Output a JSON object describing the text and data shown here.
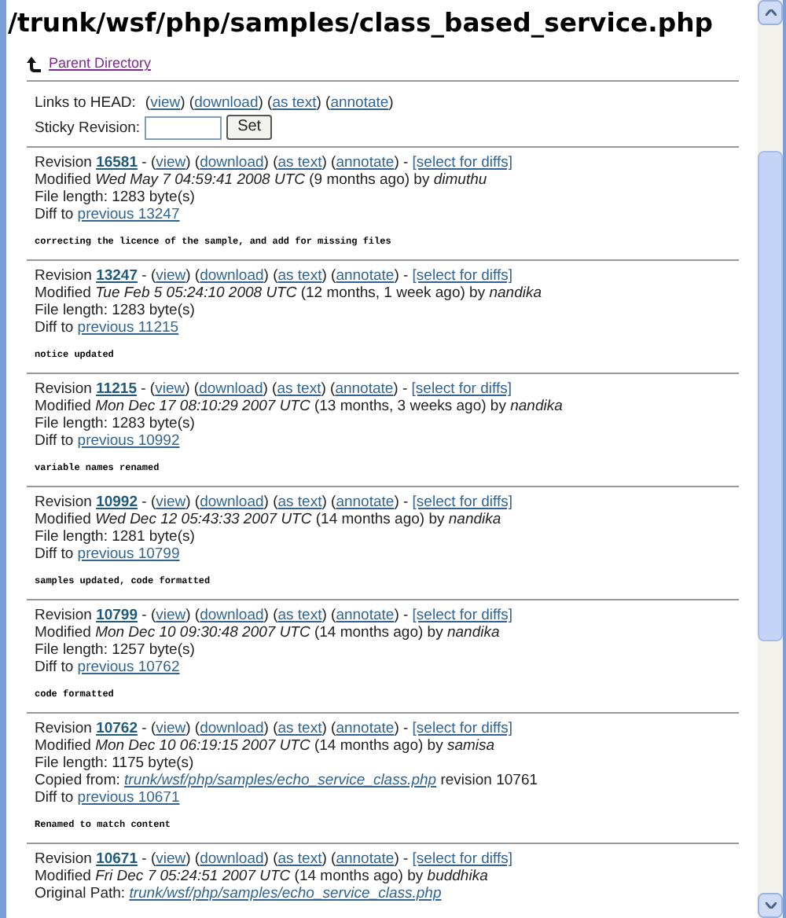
{
  "title": "/trunk/wsf/php/samples/class_based_service.php",
  "parent_link": "Parent Directory",
  "head_links": [
    {
      "text": "Links to HEAD:",
      "kind": "label"
    },
    {
      "text": "(",
      "kind": "plain"
    },
    {
      "text": "view",
      "kind": "link"
    },
    {
      "text": ") (",
      "kind": "plain"
    },
    {
      "text": "download",
      "kind": "link"
    },
    {
      "text": ") (",
      "kind": "plain"
    },
    {
      "text": "as text",
      "kind": "link"
    },
    {
      "text": ") (",
      "kind": "plain"
    },
    {
      "text": "annotate",
      "kind": "link"
    },
    {
      "text": ")",
      "kind": "plain"
    }
  ],
  "sticky": {
    "label": "Sticky Revision:",
    "button": "Set"
  },
  "revisions": [
    {
      "lines": [
        [
          {
            "text": "Revision ",
            "kind": "plain"
          },
          {
            "text": "16581",
            "kind": "bold-link"
          },
          {
            "text": " - (",
            "kind": "plain"
          },
          {
            "text": "view",
            "kind": "link"
          },
          {
            "text": ") (",
            "kind": "plain"
          },
          {
            "text": "download",
            "kind": "link"
          },
          {
            "text": ") (",
            "kind": "plain"
          },
          {
            "text": "as text",
            "kind": "link"
          },
          {
            "text": ") (",
            "kind": "plain"
          },
          {
            "text": "annotate",
            "kind": "link"
          },
          {
            "text": ") - ",
            "kind": "plain"
          },
          {
            "text": "[select for diffs]",
            "kind": "link"
          }
        ],
        [
          {
            "text": "Modified ",
            "kind": "plain"
          },
          {
            "text": "Wed May 7 04:59:41 2008 UTC",
            "kind": "italic"
          },
          {
            "text": " (9 months ago) by ",
            "kind": "plain"
          },
          {
            "text": "dimuthu",
            "kind": "italic"
          }
        ],
        [
          {
            "text": "File length: 1283 byte(s)",
            "kind": "plain"
          }
        ],
        [
          {
            "text": "Diff to ",
            "kind": "plain"
          },
          {
            "text": "previous 13247",
            "kind": "link"
          }
        ]
      ],
      "log": "correcting the licence of the sample, and add for missing files"
    },
    {
      "lines": [
        [
          {
            "text": "Revision ",
            "kind": "plain"
          },
          {
            "text": "13247",
            "kind": "bold-link"
          },
          {
            "text": " - (",
            "kind": "plain"
          },
          {
            "text": "view",
            "kind": "link"
          },
          {
            "text": ") (",
            "kind": "plain"
          },
          {
            "text": "download",
            "kind": "link"
          },
          {
            "text": ") (",
            "kind": "plain"
          },
          {
            "text": "as text",
            "kind": "link"
          },
          {
            "text": ") (",
            "kind": "plain"
          },
          {
            "text": "annotate",
            "kind": "link"
          },
          {
            "text": ") - ",
            "kind": "plain"
          },
          {
            "text": "[select for diffs]",
            "kind": "link"
          }
        ],
        [
          {
            "text": "Modified ",
            "kind": "plain"
          },
          {
            "text": "Tue Feb 5 05:24:10 2008 UTC",
            "kind": "italic"
          },
          {
            "text": " (12 months, 1 week ago) by ",
            "kind": "plain"
          },
          {
            "text": "nandika",
            "kind": "italic"
          }
        ],
        [
          {
            "text": "File length: 1283 byte(s)",
            "kind": "plain"
          }
        ],
        [
          {
            "text": "Diff to ",
            "kind": "plain"
          },
          {
            "text": "previous 11215",
            "kind": "link"
          }
        ]
      ],
      "log": "notice updated"
    },
    {
      "lines": [
        [
          {
            "text": "Revision ",
            "kind": "plain"
          },
          {
            "text": "11215",
            "kind": "bold-link"
          },
          {
            "text": " - (",
            "kind": "plain"
          },
          {
            "text": "view",
            "kind": "link"
          },
          {
            "text": ") (",
            "kind": "plain"
          },
          {
            "text": "download",
            "kind": "link"
          },
          {
            "text": ") (",
            "kind": "plain"
          },
          {
            "text": "as text",
            "kind": "link"
          },
          {
            "text": ") (",
            "kind": "plain"
          },
          {
            "text": "annotate",
            "kind": "link"
          },
          {
            "text": ") - ",
            "kind": "plain"
          },
          {
            "text": "[select for diffs]",
            "kind": "link"
          }
        ],
        [
          {
            "text": "Modified ",
            "kind": "plain"
          },
          {
            "text": "Mon Dec 17 08:10:29 2007 UTC",
            "kind": "italic"
          },
          {
            "text": " (13 months, 3 weeks ago) by ",
            "kind": "plain"
          },
          {
            "text": "nandika",
            "kind": "italic"
          }
        ],
        [
          {
            "text": "File length: 1283 byte(s)",
            "kind": "plain"
          }
        ],
        [
          {
            "text": "Diff to ",
            "kind": "plain"
          },
          {
            "text": "previous 10992",
            "kind": "link"
          }
        ]
      ],
      "log": "variable names renamed"
    },
    {
      "lines": [
        [
          {
            "text": "Revision ",
            "kind": "plain"
          },
          {
            "text": "10992",
            "kind": "bold-link"
          },
          {
            "text": " - (",
            "kind": "plain"
          },
          {
            "text": "view",
            "kind": "link"
          },
          {
            "text": ") (",
            "kind": "plain"
          },
          {
            "text": "download",
            "kind": "link"
          },
          {
            "text": ") (",
            "kind": "plain"
          },
          {
            "text": "as text",
            "kind": "link"
          },
          {
            "text": ") (",
            "kind": "plain"
          },
          {
            "text": "annotate",
            "kind": "link"
          },
          {
            "text": ") - ",
            "kind": "plain"
          },
          {
            "text": "[select for diffs]",
            "kind": "link"
          }
        ],
        [
          {
            "text": "Modified ",
            "kind": "plain"
          },
          {
            "text": "Wed Dec 12 05:43:33 2007 UTC",
            "kind": "italic"
          },
          {
            "text": " (14 months ago) by ",
            "kind": "plain"
          },
          {
            "text": "nandika",
            "kind": "italic"
          }
        ],
        [
          {
            "text": "File length: 1281 byte(s)",
            "kind": "plain"
          }
        ],
        [
          {
            "text": "Diff to ",
            "kind": "plain"
          },
          {
            "text": "previous 10799",
            "kind": "link"
          }
        ]
      ],
      "log": "samples updated, code formatted"
    },
    {
      "lines": [
        [
          {
            "text": "Revision ",
            "kind": "plain"
          },
          {
            "text": "10799",
            "kind": "bold-link"
          },
          {
            "text": " - (",
            "kind": "plain"
          },
          {
            "text": "view",
            "kind": "link"
          },
          {
            "text": ") (",
            "kind": "plain"
          },
          {
            "text": "download",
            "kind": "link"
          },
          {
            "text": ") (",
            "kind": "plain"
          },
          {
            "text": "as text",
            "kind": "link"
          },
          {
            "text": ") (",
            "kind": "plain"
          },
          {
            "text": "annotate",
            "kind": "link"
          },
          {
            "text": ") - ",
            "kind": "plain"
          },
          {
            "text": "[select for diffs]",
            "kind": "link"
          }
        ],
        [
          {
            "text": "Modified ",
            "kind": "plain"
          },
          {
            "text": "Mon Dec 10 09:30:48 2007 UTC",
            "kind": "italic"
          },
          {
            "text": " (14 months ago) by ",
            "kind": "plain"
          },
          {
            "text": "nandika",
            "kind": "italic"
          }
        ],
        [
          {
            "text": "File length: 1257 byte(s)",
            "kind": "plain"
          }
        ],
        [
          {
            "text": "Diff to ",
            "kind": "plain"
          },
          {
            "text": "previous 10762",
            "kind": "link"
          }
        ]
      ],
      "log": "code formatted"
    },
    {
      "lines": [
        [
          {
            "text": "Revision ",
            "kind": "plain"
          },
          {
            "text": "10762",
            "kind": "bold-link"
          },
          {
            "text": " - (",
            "kind": "plain"
          },
          {
            "text": "view",
            "kind": "link"
          },
          {
            "text": ") (",
            "kind": "plain"
          },
          {
            "text": "download",
            "kind": "link"
          },
          {
            "text": ") (",
            "kind": "plain"
          },
          {
            "text": "as text",
            "kind": "link"
          },
          {
            "text": ") (",
            "kind": "plain"
          },
          {
            "text": "annotate",
            "kind": "link"
          },
          {
            "text": ") - ",
            "kind": "plain"
          },
          {
            "text": "[select for diffs]",
            "kind": "link"
          }
        ],
        [
          {
            "text": "Modified ",
            "kind": "plain"
          },
          {
            "text": "Mon Dec 10 06:19:15 2007 UTC",
            "kind": "italic"
          },
          {
            "text": " (14 months ago) by ",
            "kind": "plain"
          },
          {
            "text": "samisa",
            "kind": "italic"
          }
        ],
        [
          {
            "text": "File length: 1175 byte(s)",
            "kind": "plain"
          }
        ],
        [
          {
            "text": "Copied from: ",
            "kind": "plain"
          },
          {
            "text": "trunk/wsf/php/samples/echo_service_class.php",
            "kind": "italic-link"
          },
          {
            "text": " revision 10761",
            "kind": "plain"
          }
        ],
        [
          {
            "text": "Diff to ",
            "kind": "plain"
          },
          {
            "text": "previous 10671",
            "kind": "link"
          }
        ]
      ],
      "log": "Renamed to match content"
    },
    {
      "lines": [
        [
          {
            "text": "Revision ",
            "kind": "plain"
          },
          {
            "text": "10671",
            "kind": "bold-link"
          },
          {
            "text": " - (",
            "kind": "plain"
          },
          {
            "text": "view",
            "kind": "link"
          },
          {
            "text": ") (",
            "kind": "plain"
          },
          {
            "text": "download",
            "kind": "link"
          },
          {
            "text": ") (",
            "kind": "plain"
          },
          {
            "text": "as text",
            "kind": "link"
          },
          {
            "text": ") (",
            "kind": "plain"
          },
          {
            "text": "annotate",
            "kind": "link"
          },
          {
            "text": ") - ",
            "kind": "plain"
          },
          {
            "text": "[select for diffs]",
            "kind": "link"
          }
        ],
        [
          {
            "text": "Modified ",
            "kind": "plain"
          },
          {
            "text": "Fri Dec 7 05:24:51 2007 UTC",
            "kind": "italic"
          },
          {
            "text": " (14 months ago) by ",
            "kind": "plain"
          },
          {
            "text": "buddhika",
            "kind": "italic"
          }
        ],
        [
          {
            "text": "Original Path: ",
            "kind": "plain"
          },
          {
            "text": "trunk/wsf/php/samples/echo_service_class.php",
            "kind": "italic-link"
          }
        ]
      ]
    }
  ]
}
